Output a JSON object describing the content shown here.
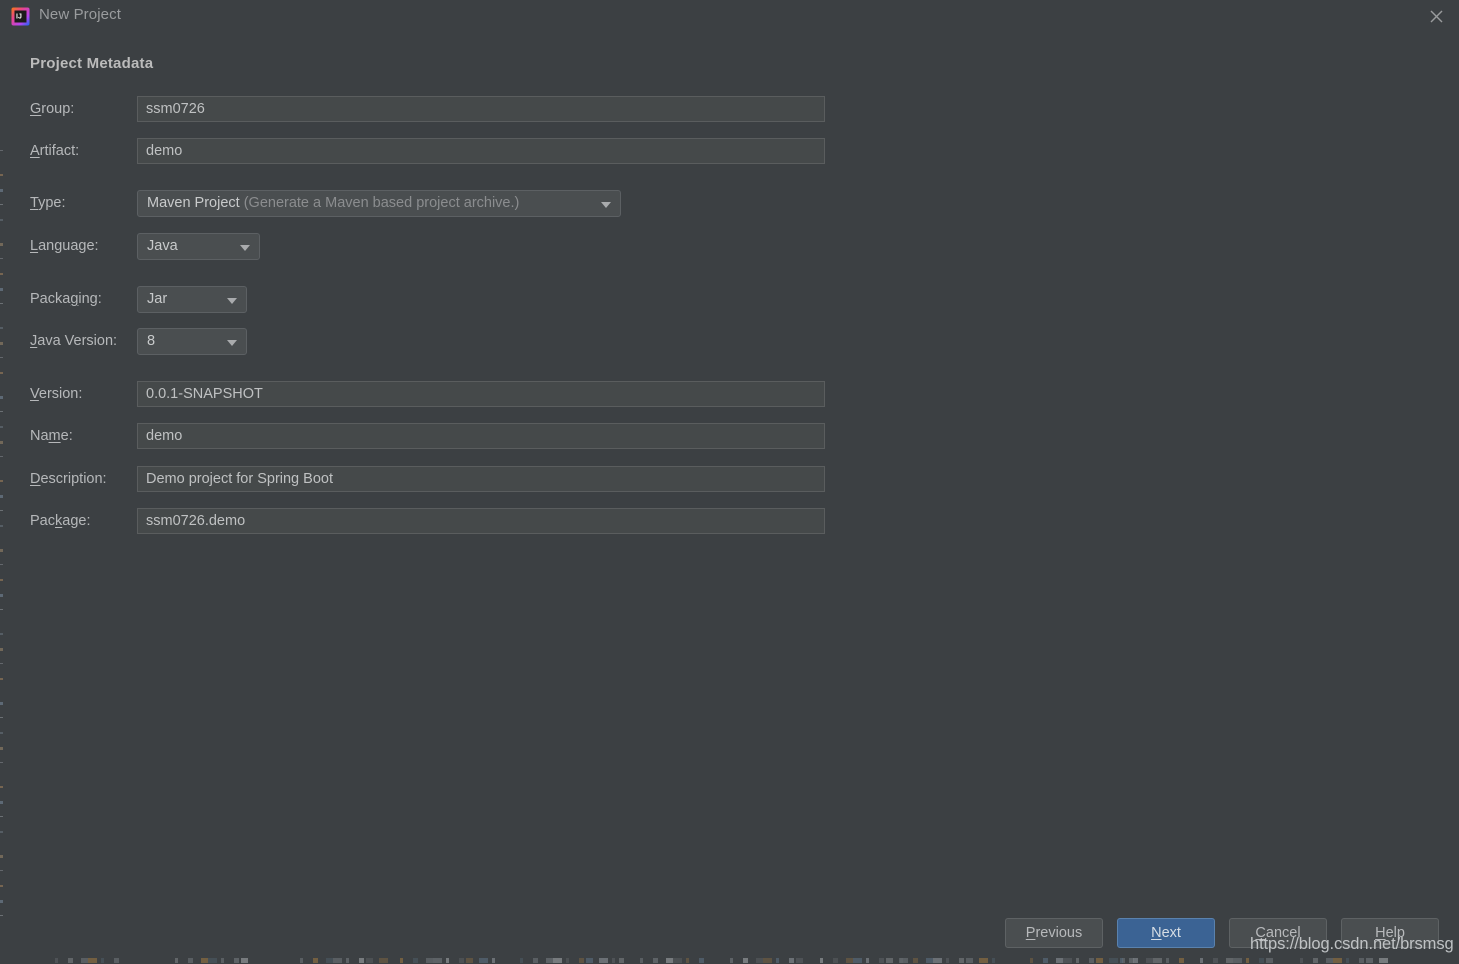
{
  "window": {
    "title": "New Project",
    "app_icon": "intellij-idea-icon",
    "close_icon": "close-icon",
    "background_color": "#3c4043"
  },
  "section": {
    "title": "Project Metadata"
  },
  "form": {
    "rows": [
      {
        "label": "Group:",
        "mnemonic": "G",
        "control": "text",
        "value": "ssm0726"
      },
      {
        "label": "Artifact:",
        "mnemonic": "A",
        "control": "text",
        "value": "demo"
      },
      {
        "label": "Type:",
        "mnemonic": "T",
        "control": "combo",
        "value": "Maven Project",
        "hint": "(Generate a Maven based project archive.)"
      },
      {
        "label": "Language:",
        "mnemonic": "L",
        "control": "combo",
        "value": "Java"
      },
      {
        "label": "Packaging:",
        "mnemonic": "g",
        "control": "combo",
        "value": "Jar"
      },
      {
        "label": "Java Version:",
        "mnemonic": "J",
        "control": "combo",
        "value": "8"
      },
      {
        "label": "Version:",
        "mnemonic": "V",
        "control": "text",
        "value": "0.0.1-SNAPSHOT"
      },
      {
        "label": "Name:",
        "mnemonic": "m",
        "control": "text",
        "value": "demo"
      },
      {
        "label": "Description:",
        "mnemonic": "D",
        "control": "text",
        "value": "Demo project for Spring Boot"
      },
      {
        "label": "Package:",
        "mnemonic": "k",
        "control": "text",
        "value": "ssm0726.demo"
      }
    ]
  },
  "footer": {
    "buttons": [
      {
        "label": "Previous",
        "mnemonic": "P",
        "primary": false
      },
      {
        "label": "Next",
        "mnemonic": "N",
        "primary": true
      },
      {
        "label": "Cancel",
        "mnemonic": "C",
        "primary": false
      },
      {
        "label": "Help",
        "mnemonic": "H",
        "primary": false
      }
    ]
  },
  "watermark": {
    "text": "https://blog.csdn.net/brsmsg"
  },
  "colors": {
    "dialog_bg": "#3c4043",
    "field_bg": "#45494a",
    "field_border": "#5a5d5e",
    "combo_bg": "#4a4e50",
    "primary_button": "#3b6394",
    "text": "#b6b8ba",
    "dim_text": "#8b8d8f"
  }
}
